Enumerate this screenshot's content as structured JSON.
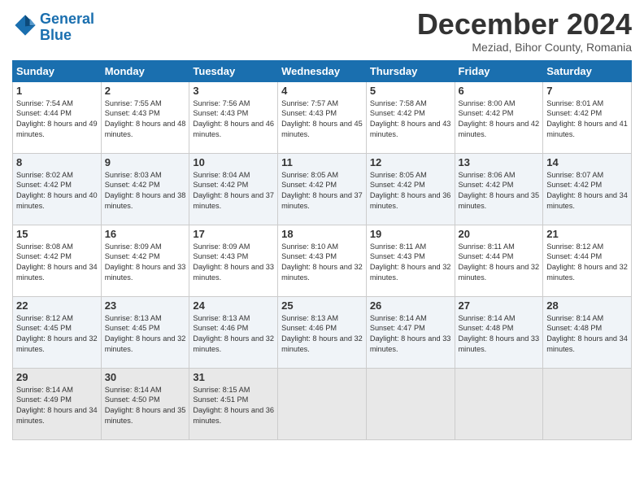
{
  "logo": {
    "line1": "General",
    "line2": "Blue"
  },
  "title": "December 2024",
  "subtitle": "Meziad, Bihor County, Romania",
  "days_header": [
    "Sunday",
    "Monday",
    "Tuesday",
    "Wednesday",
    "Thursday",
    "Friday",
    "Saturday"
  ],
  "weeks": [
    [
      {
        "day": "1",
        "sunrise": "7:54 AM",
        "sunset": "4:44 PM",
        "daylight": "8 hours and 49 minutes."
      },
      {
        "day": "2",
        "sunrise": "7:55 AM",
        "sunset": "4:43 PM",
        "daylight": "8 hours and 48 minutes."
      },
      {
        "day": "3",
        "sunrise": "7:56 AM",
        "sunset": "4:43 PM",
        "daylight": "8 hours and 46 minutes."
      },
      {
        "day": "4",
        "sunrise": "7:57 AM",
        "sunset": "4:43 PM",
        "daylight": "8 hours and 45 minutes."
      },
      {
        "day": "5",
        "sunrise": "7:58 AM",
        "sunset": "4:42 PM",
        "daylight": "8 hours and 43 minutes."
      },
      {
        "day": "6",
        "sunrise": "8:00 AM",
        "sunset": "4:42 PM",
        "daylight": "8 hours and 42 minutes."
      },
      {
        "day": "7",
        "sunrise": "8:01 AM",
        "sunset": "4:42 PM",
        "daylight": "8 hours and 41 minutes."
      }
    ],
    [
      {
        "day": "8",
        "sunrise": "8:02 AM",
        "sunset": "4:42 PM",
        "daylight": "8 hours and 40 minutes."
      },
      {
        "day": "9",
        "sunrise": "8:03 AM",
        "sunset": "4:42 PM",
        "daylight": "8 hours and 38 minutes."
      },
      {
        "day": "10",
        "sunrise": "8:04 AM",
        "sunset": "4:42 PM",
        "daylight": "8 hours and 37 minutes."
      },
      {
        "day": "11",
        "sunrise": "8:05 AM",
        "sunset": "4:42 PM",
        "daylight": "8 hours and 37 minutes."
      },
      {
        "day": "12",
        "sunrise": "8:05 AM",
        "sunset": "4:42 PM",
        "daylight": "8 hours and 36 minutes."
      },
      {
        "day": "13",
        "sunrise": "8:06 AM",
        "sunset": "4:42 PM",
        "daylight": "8 hours and 35 minutes."
      },
      {
        "day": "14",
        "sunrise": "8:07 AM",
        "sunset": "4:42 PM",
        "daylight": "8 hours and 34 minutes."
      }
    ],
    [
      {
        "day": "15",
        "sunrise": "8:08 AM",
        "sunset": "4:42 PM",
        "daylight": "8 hours and 34 minutes."
      },
      {
        "day": "16",
        "sunrise": "8:09 AM",
        "sunset": "4:42 PM",
        "daylight": "8 hours and 33 minutes."
      },
      {
        "day": "17",
        "sunrise": "8:09 AM",
        "sunset": "4:43 PM",
        "daylight": "8 hours and 33 minutes."
      },
      {
        "day": "18",
        "sunrise": "8:10 AM",
        "sunset": "4:43 PM",
        "daylight": "8 hours and 32 minutes."
      },
      {
        "day": "19",
        "sunrise": "8:11 AM",
        "sunset": "4:43 PM",
        "daylight": "8 hours and 32 minutes."
      },
      {
        "day": "20",
        "sunrise": "8:11 AM",
        "sunset": "4:44 PM",
        "daylight": "8 hours and 32 minutes."
      },
      {
        "day": "21",
        "sunrise": "8:12 AM",
        "sunset": "4:44 PM",
        "daylight": "8 hours and 32 minutes."
      }
    ],
    [
      {
        "day": "22",
        "sunrise": "8:12 AM",
        "sunset": "4:45 PM",
        "daylight": "8 hours and 32 minutes."
      },
      {
        "day": "23",
        "sunrise": "8:13 AM",
        "sunset": "4:45 PM",
        "daylight": "8 hours and 32 minutes."
      },
      {
        "day": "24",
        "sunrise": "8:13 AM",
        "sunset": "4:46 PM",
        "daylight": "8 hours and 32 minutes."
      },
      {
        "day": "25",
        "sunrise": "8:13 AM",
        "sunset": "4:46 PM",
        "daylight": "8 hours and 32 minutes."
      },
      {
        "day": "26",
        "sunrise": "8:14 AM",
        "sunset": "4:47 PM",
        "daylight": "8 hours and 33 minutes."
      },
      {
        "day": "27",
        "sunrise": "8:14 AM",
        "sunset": "4:48 PM",
        "daylight": "8 hours and 33 minutes."
      },
      {
        "day": "28",
        "sunrise": "8:14 AM",
        "sunset": "4:48 PM",
        "daylight": "8 hours and 34 minutes."
      }
    ],
    [
      {
        "day": "29",
        "sunrise": "8:14 AM",
        "sunset": "4:49 PM",
        "daylight": "8 hours and 34 minutes."
      },
      {
        "day": "30",
        "sunrise": "8:14 AM",
        "sunset": "4:50 PM",
        "daylight": "8 hours and 35 minutes."
      },
      {
        "day": "31",
        "sunrise": "8:15 AM",
        "sunset": "4:51 PM",
        "daylight": "8 hours and 36 minutes."
      },
      null,
      null,
      null,
      null
    ]
  ]
}
